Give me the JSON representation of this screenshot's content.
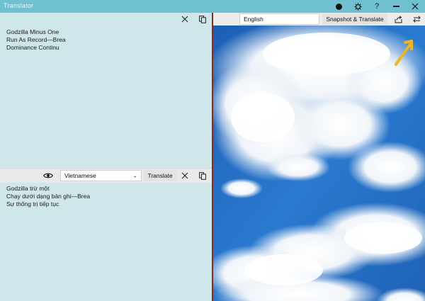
{
  "app": {
    "title": "Translator"
  },
  "titlebar": {
    "icons": [
      "record-icon",
      "gear-icon",
      "help-icon",
      "minimize-icon",
      "close-icon"
    ]
  },
  "source": {
    "lines": [
      "Godzilla Minus One",
      "Run As Record—Brea",
      "Dominance Continu"
    ]
  },
  "target": {
    "language": "Vietnamese",
    "translate_label": "Translate",
    "lines": [
      "Godzilla trừ một",
      "Chạy dưới dạng bản ghi—Brea",
      "Sự thống trị tiếp tục"
    ]
  },
  "snapshot": {
    "language": "English",
    "button_label": "Snapshot & Translate"
  },
  "colors": {
    "titlebar": "#6fc0d0",
    "pane": "#cfe6ea",
    "divider": "#8b2a1e",
    "arrow": "#f2b41a"
  }
}
